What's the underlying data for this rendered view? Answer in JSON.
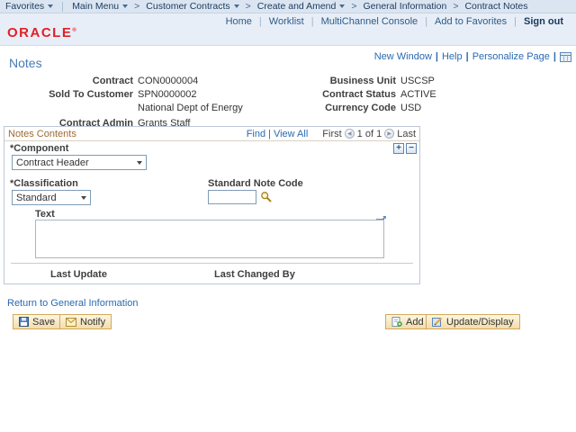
{
  "breadcrumb": {
    "favorites": "Favorites",
    "separator": ">",
    "items": [
      {
        "label": "Main Menu"
      },
      {
        "label": "Customer Contracts"
      },
      {
        "label": "Create and Amend"
      },
      {
        "label": "General Information"
      },
      {
        "label": "Contract Notes"
      }
    ]
  },
  "banner": {
    "logo_text": "ORACLE",
    "logo_mark": "®",
    "separator": "|",
    "links": [
      {
        "label": "Home"
      },
      {
        "label": "Worklist"
      },
      {
        "label": "MultiChannel Console"
      },
      {
        "label": "Add to Favorites"
      }
    ],
    "signout_label": "Sign out"
  },
  "page_links": {
    "new_window": "New Window",
    "help": "Help",
    "personalize": "Personalize Page",
    "separator": "|"
  },
  "page": {
    "title": "Notes"
  },
  "fields": {
    "contract": {
      "label": "Contract",
      "value": "CON0000004"
    },
    "sold_to_customer": {
      "label": "Sold To Customer",
      "value": "SPN0000002"
    },
    "customer_name": "National Dept of Energy",
    "contract_admin": {
      "label": "Contract Admin",
      "value": "Grants Staff"
    },
    "business_unit": {
      "label": "Business Unit",
      "value": "USCSP"
    },
    "contract_status": {
      "label": "Contract Status",
      "value": "ACTIVE"
    },
    "currency_code": {
      "label": "Currency Code",
      "value": "USD"
    }
  },
  "notes_contents": {
    "title": "Notes Contents",
    "find_label": "Find",
    "view_all_label": "View All",
    "separator": "|",
    "pager": {
      "first": "First",
      "position": "1 of 1",
      "last": "Last"
    },
    "component": {
      "label": "*Component",
      "selected": "Contract Header"
    },
    "classification": {
      "label": "*Classification",
      "selected": "Standard"
    },
    "standard_note_code": {
      "label": "Standard Note Code",
      "value": ""
    },
    "text_field": {
      "label": "Text",
      "value": ""
    },
    "last_update_label": "Last Update",
    "last_changed_by_label": "Last Changed By"
  },
  "links": {
    "return": "Return to General Information"
  },
  "toolbar": {
    "save": "Save",
    "notify": "Notify",
    "add": "Add",
    "update_display": "Update/Display"
  },
  "colors": {
    "breadcrumb_bg": "#dbe5f1",
    "banner_bg": "#e8eef7",
    "logo_red": "#e21f26",
    "link_blue": "#2a6ab0",
    "group_title_brown": "#9e6b30",
    "button_bg": "#f6e4b9",
    "button_border": "#d3a95c",
    "input_border": "#7f9db9"
  }
}
